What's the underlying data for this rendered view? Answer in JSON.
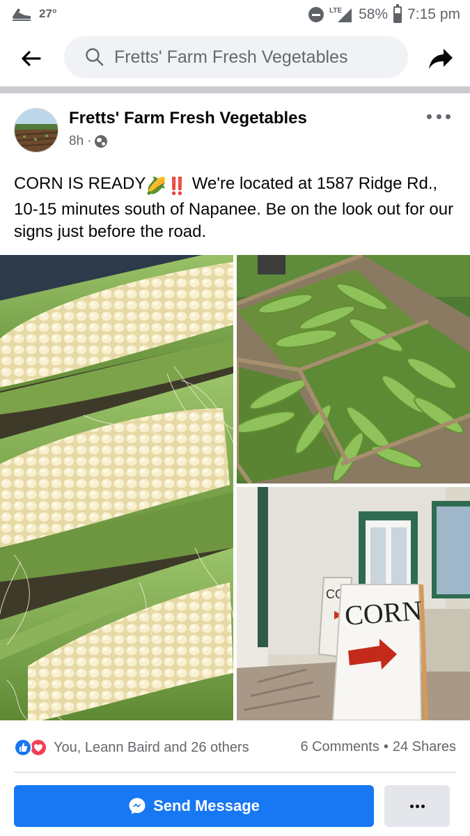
{
  "status_bar": {
    "temperature": "27°",
    "network": "LTE",
    "battery": "58%",
    "battery_level": 0.58,
    "time": "7:15 pm"
  },
  "header": {
    "search_text": "Fretts' Farm Fresh Vegetables",
    "icons": [
      "back-arrow-icon",
      "search-icon",
      "share-icon"
    ]
  },
  "post": {
    "author": "Fretts' Farm Fresh Vegetables",
    "time_ago": "8h",
    "separator": "·",
    "text_part1": "CORN IS READY",
    "text_emoji": "🌽‼️",
    "text_part2": " We're located at 1587 Ridge Rd., 10-15 minutes south of Napanee. Be on the look out for our signs just before the road.",
    "photos": [
      {
        "name": "corn-cobs-photo"
      },
      {
        "name": "corn-crates-photo"
      },
      {
        "name": "corn-sign-photo",
        "sign_text": "CORN",
        "sign_text_back": "CORN"
      }
    ]
  },
  "engagement": {
    "reaction_names": "You, Leann Baird and 26 others",
    "comments": "6 Comments",
    "separator": "•",
    "shares": "24 Shares"
  },
  "actions": {
    "send_message_label": "Send Message"
  },
  "colors": {
    "primary": "#1877f2",
    "love": "#f33e58",
    "secondary_text": "#65676b",
    "button_gray": "#e4e6eb"
  }
}
